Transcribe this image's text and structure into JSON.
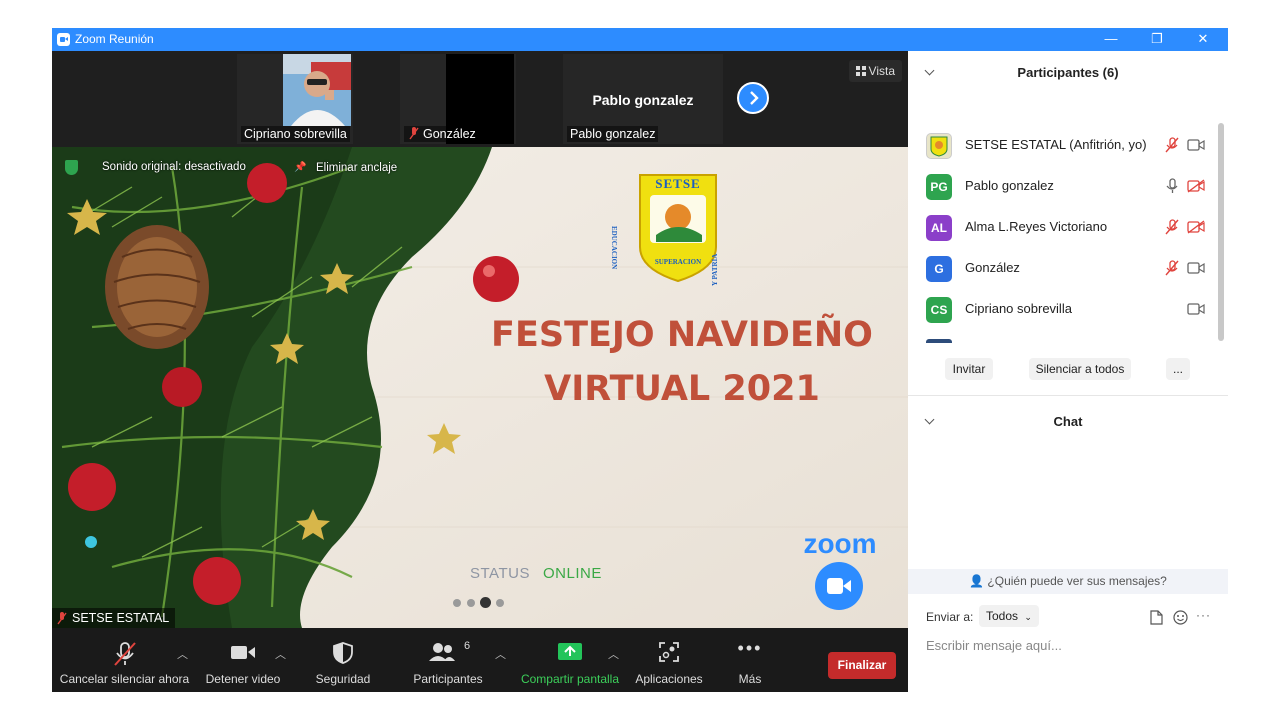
{
  "window": {
    "title": "Zoom Reunión",
    "controls": {
      "minimize": "—",
      "restore": "❐",
      "close": "✕"
    }
  },
  "video_strip": {
    "tiles": [
      {
        "name": "Cipriano sobrevilla",
        "muted": false
      },
      {
        "name": "González",
        "muted": true
      },
      {
        "name": "Pablo gonzalez",
        "display_name": "Pablo gonzalez",
        "muted": false
      }
    ],
    "view_button": "Vista"
  },
  "stage": {
    "original_sound": "Sonido original: desactivado",
    "unpin": "Eliminar anclaje",
    "logo_text_top": "SETSE",
    "logo_text_left": "EDUCACION",
    "logo_text_right": "Y PATRIA",
    "logo_text_bottom": "SUPERACION",
    "headline_line1": "FESTEJO NAVIDEÑO",
    "headline_line2": "VIRTUAL 2021",
    "status_label": "STATUS",
    "status_value": "ONLINE",
    "zoom_brand": "zoom",
    "active_speaker": "SETSE ESTATAL",
    "colors": {
      "headline": "#c0503a",
      "status_value": "#3aa845",
      "zoom_blue": "#2d8cff"
    }
  },
  "toolbar": {
    "mute": "Cancelar silenciar ahora",
    "video": "Detener video",
    "security": "Seguridad",
    "participants": "Participantes",
    "participants_count": "6",
    "share": "Compartir pantalla",
    "apps": "Aplicaciones",
    "more": "Más",
    "end": "Finalizar"
  },
  "participants_panel": {
    "title": "Participantes (6)",
    "items": [
      {
        "initials": "",
        "name": "SETSE ESTATAL (Anfitrión, yo)",
        "color": "#e8e5c8",
        "mic": "muted",
        "cam": "on"
      },
      {
        "initials": "PG",
        "name": "Pablo gonzalez",
        "color": "#2ea44f",
        "mic": "on",
        "cam": "off"
      },
      {
        "initials": "AL",
        "name": "Alma L.Reyes Victoriano",
        "color": "#8b3fc9",
        "mic": "muted",
        "cam": "off"
      },
      {
        "initials": "G",
        "name": "González",
        "color": "#2d6fe0",
        "mic": "muted",
        "cam": "on"
      },
      {
        "initials": "CS",
        "name": "Cipriano sobrevilla",
        "color": "#2ea44f",
        "mic": "none",
        "cam": "on"
      }
    ],
    "invite": "Invitar",
    "mute_all": "Silenciar a todos",
    "more": "..."
  },
  "chat": {
    "title": "Chat",
    "who_can_see": "¿Quién puede ver sus mensajes?",
    "send_to_label": "Enviar a:",
    "send_to_value": "Todos",
    "placeholder": "Escribir mensaje aquí..."
  }
}
